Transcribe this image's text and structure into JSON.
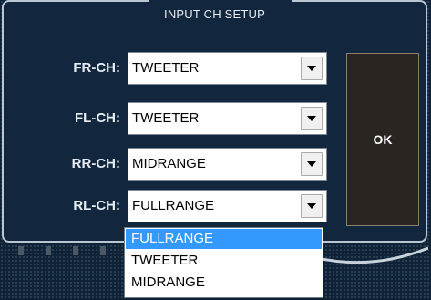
{
  "dialog": {
    "title": "INPUT CH SETUP",
    "ok_label": "OK"
  },
  "channels": [
    {
      "label": "FR-CH:",
      "value": "TWEETER"
    },
    {
      "label": "FL-CH:",
      "value": "TWEETER"
    },
    {
      "label": "RR-CH:",
      "value": "MIDRANGE"
    },
    {
      "label": "RL-CH:",
      "value": "FULLRANGE"
    }
  ],
  "dropdown": {
    "options": [
      "FULLRANGE",
      "TWEETER",
      "MIDRANGE"
    ],
    "highlighted": "FULLRANGE"
  },
  "colors": {
    "background": "#0f2236",
    "highlight": "#3399ff",
    "ok_button": "#2a2520"
  }
}
